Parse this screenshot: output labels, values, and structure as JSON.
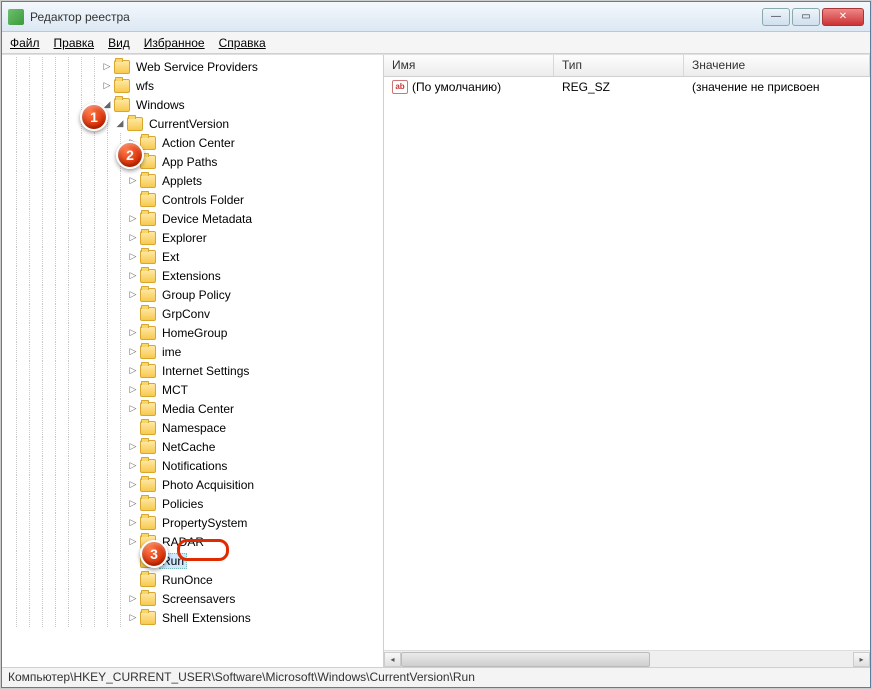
{
  "window": {
    "title": "Редактор реестра"
  },
  "menu": {
    "file": "Файл",
    "edit": "Правка",
    "view": "Вид",
    "favorites": "Избранное",
    "help": "Справка"
  },
  "tree": {
    "top": [
      {
        "label": "Web Service Providers",
        "expander": "▷"
      },
      {
        "label": "wfs",
        "expander": "▷"
      }
    ],
    "windows": {
      "label": "Windows",
      "expander": "◢"
    },
    "currentVersion": {
      "label": "CurrentVersion",
      "expander": "◢"
    },
    "children": [
      {
        "label": "Action Center",
        "expander": "▷"
      },
      {
        "label": "App Paths",
        "expander": "▷"
      },
      {
        "label": "Applets",
        "expander": "▷"
      },
      {
        "label": "Controls Folder",
        "expander": ""
      },
      {
        "label": "Device Metadata",
        "expander": "▷"
      },
      {
        "label": "Explorer",
        "expander": "▷"
      },
      {
        "label": "Ext",
        "expander": "▷"
      },
      {
        "label": "Extensions",
        "expander": "▷"
      },
      {
        "label": "Group Policy",
        "expander": "▷"
      },
      {
        "label": "GrpConv",
        "expander": ""
      },
      {
        "label": "HomeGroup",
        "expander": "▷"
      },
      {
        "label": "ime",
        "expander": "▷"
      },
      {
        "label": "Internet Settings",
        "expander": "▷"
      },
      {
        "label": "MCT",
        "expander": "▷"
      },
      {
        "label": "Media Center",
        "expander": "▷"
      },
      {
        "label": "Namespace",
        "expander": ""
      },
      {
        "label": "NetCache",
        "expander": "▷"
      },
      {
        "label": "Notifications",
        "expander": "▷"
      },
      {
        "label": "Photo Acquisition",
        "expander": "▷"
      },
      {
        "label": "Policies",
        "expander": "▷"
      },
      {
        "label": "PropertySystem",
        "expander": "▷"
      },
      {
        "label": "RADAR",
        "expander": "▷"
      },
      {
        "label": "Run",
        "expander": "",
        "selected": true
      },
      {
        "label": "RunOnce",
        "expander": ""
      },
      {
        "label": "Screensavers",
        "expander": "▷"
      },
      {
        "label": "Shell Extensions",
        "expander": "▷"
      }
    ]
  },
  "list": {
    "columns": {
      "name": "Имя",
      "type": "Тип",
      "value": "Значение"
    },
    "rows": [
      {
        "name": "(По умолчанию)",
        "type": "REG_SZ",
        "value": "(значение не присвоен"
      }
    ]
  },
  "status": {
    "path": "Компьютер\\HKEY_CURRENT_USER\\Software\\Microsoft\\Windows\\CurrentVersion\\Run"
  },
  "annotations": {
    "b1": "1",
    "b2": "2",
    "b3": "3"
  }
}
